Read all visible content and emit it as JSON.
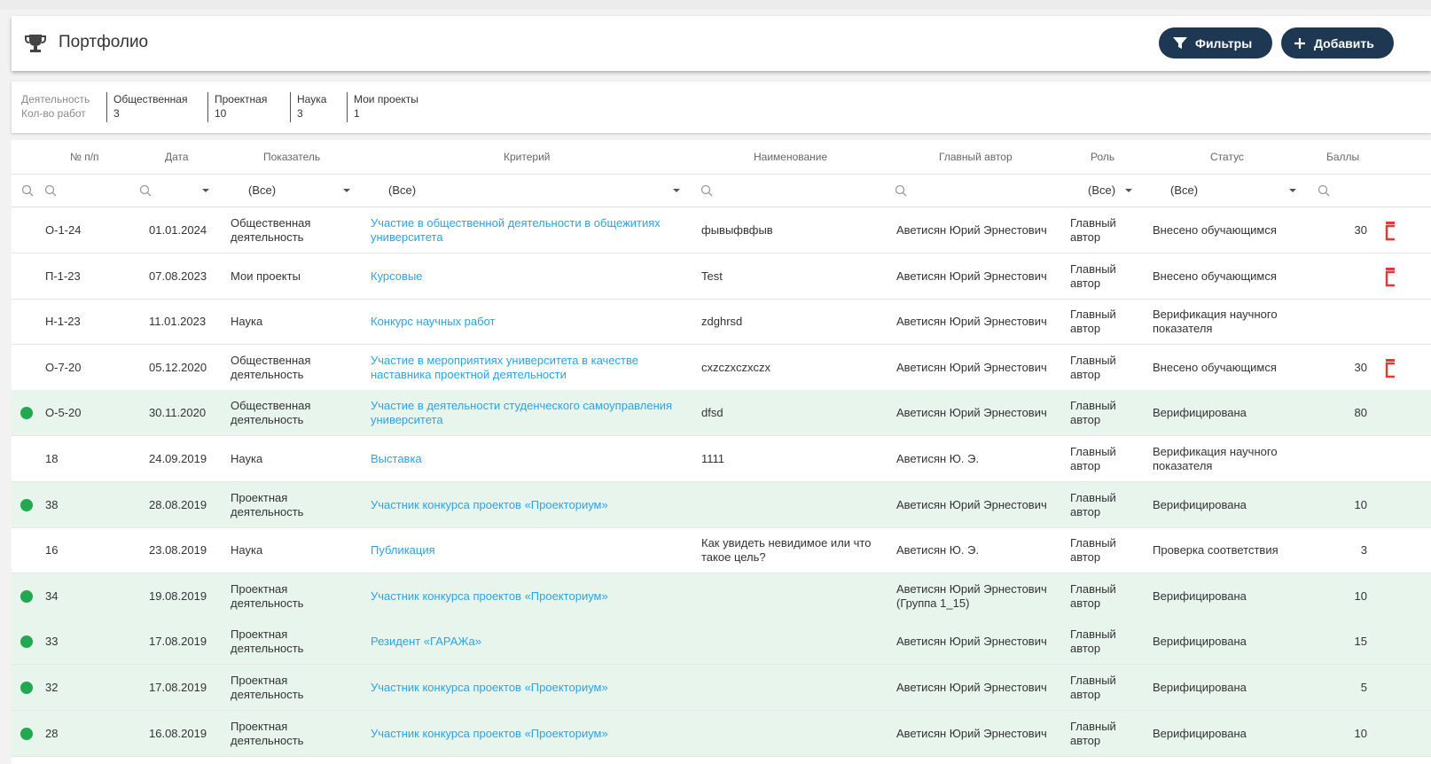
{
  "header": {
    "title": "Портфолио",
    "filters_label": "Фильтры",
    "add_label": "Добавить",
    "icons": {
      "title": "trophy-icon",
      "filters": "filter-icon",
      "add": "plus-icon"
    },
    "button_color": "#1e3752"
  },
  "stats": {
    "label_activity": "Деятельность",
    "label_count": "Кол-во работ",
    "items": [
      {
        "name": "Общественная",
        "count": "3"
      },
      {
        "name": "Проектная",
        "count": "10"
      },
      {
        "name": "Наука",
        "count": "3"
      },
      {
        "name": "Мои проекты",
        "count": "1"
      }
    ]
  },
  "table": {
    "columns": {
      "num": "№ п/п",
      "date": "Дата",
      "indicator": "Показатель",
      "criterion": "Критерий",
      "name": "Наименование",
      "author": "Главный автор",
      "role": "Роль",
      "status": "Статус",
      "score": "Баллы"
    },
    "filters": {
      "indicator": "(Все)",
      "criterion": "(Все)",
      "role": "(Все)",
      "status": "(Все)"
    },
    "rows": [
      {
        "verified": false,
        "num": "О-1-24",
        "date": "01.01.2024",
        "indicator": [
          "Общественная",
          "деятельность"
        ],
        "criterion": [
          "Участие в общественной деятельности в общежитиях",
          "университета"
        ],
        "name": [
          "фывыфвфыв"
        ],
        "author": [
          "Аветисян Юрий Эрнестович"
        ],
        "role": [
          "Главный",
          "автор"
        ],
        "status": [
          "Внесено обучающимся"
        ],
        "score": "30",
        "deletable": true
      },
      {
        "verified": false,
        "num": "П-1-23",
        "date": "07.08.2023",
        "indicator": [
          "Мои проекты"
        ],
        "criterion": [
          "Курсовые"
        ],
        "name": [
          "Test"
        ],
        "author": [
          "Аветисян Юрий Эрнестович"
        ],
        "role": [
          "Главный",
          "автор"
        ],
        "status": [
          "Внесено обучающимся"
        ],
        "score": "",
        "deletable": true
      },
      {
        "verified": false,
        "num": "Н-1-23",
        "date": "11.01.2023",
        "indicator": [
          "Наука"
        ],
        "criterion": [
          "Конкурс научных работ"
        ],
        "name": [
          "zdghrsd"
        ],
        "author": [
          "Аветисян Юрий Эрнестович"
        ],
        "role": [
          "Главный",
          "автор"
        ],
        "status": [
          "Верификация научного",
          "показателя"
        ],
        "score": "",
        "deletable": false
      },
      {
        "verified": false,
        "num": "О-7-20",
        "date": "05.12.2020",
        "indicator": [
          "Общественная",
          "деятельность"
        ],
        "criterion": [
          "Участие в мероприятиях университета в качестве",
          "наставника проектной деятельности"
        ],
        "name": [
          "cxzczxczxczx"
        ],
        "author": [
          "Аветисян Юрий Эрнестович"
        ],
        "role": [
          "Главный",
          "автор"
        ],
        "status": [
          "Внесено обучающимся"
        ],
        "score": "30",
        "deletable": true
      },
      {
        "verified": true,
        "num": "О-5-20",
        "date": "30.11.2020",
        "indicator": [
          "Общественная",
          "деятельность"
        ],
        "criterion": [
          "Участие в деятельности студенческого самоуправления",
          "университета"
        ],
        "name": [
          "dfsd"
        ],
        "author": [
          "Аветисян Юрий Эрнестович"
        ],
        "role": [
          "Главный",
          "автор"
        ],
        "status": [
          "Верифицирована"
        ],
        "score": "80",
        "deletable": false
      },
      {
        "verified": false,
        "num": "18",
        "date": "24.09.2019",
        "indicator": [
          "Наука"
        ],
        "criterion": [
          "Выставка"
        ],
        "name": [
          "1111"
        ],
        "author": [
          "Аветисян Ю. Э."
        ],
        "role": [
          "Главный",
          "автор"
        ],
        "status": [
          "Верификация научного",
          "показателя"
        ],
        "score": "",
        "deletable": false
      },
      {
        "verified": true,
        "num": "38",
        "date": "28.08.2019",
        "indicator": [
          "Проектная",
          "деятельность"
        ],
        "criterion": [
          "Участник конкурса проектов «Проекториум»"
        ],
        "name": [
          ""
        ],
        "author": [
          "Аветисян Юрий Эрнестович"
        ],
        "role": [
          "Главный",
          "автор"
        ],
        "status": [
          "Верифицирована"
        ],
        "score": "10",
        "deletable": false
      },
      {
        "verified": false,
        "num": "16",
        "date": "23.08.2019",
        "indicator": [
          "Наука"
        ],
        "criterion": [
          "Публикация"
        ],
        "name": [
          "Как увидеть невидимое или что",
          "такое цель?"
        ],
        "author": [
          "Аветисян Ю. Э."
        ],
        "role": [
          "Главный",
          "автор"
        ],
        "status": [
          "Проверка соответствия"
        ],
        "score": "3",
        "deletable": false
      },
      {
        "verified": true,
        "num": "34",
        "date": "19.08.2019",
        "indicator": [
          "Проектная",
          "деятельность"
        ],
        "criterion": [
          "Участник конкурса проектов «Проекториум»"
        ],
        "name": [
          ""
        ],
        "author": [
          "Аветисян Юрий Эрнестович",
          "(Группа 1_15)"
        ],
        "role": [
          "Главный",
          "автор"
        ],
        "status": [
          "Верифицирована"
        ],
        "score": "10",
        "deletable": false
      },
      {
        "verified": true,
        "num": "33",
        "date": "17.08.2019",
        "indicator": [
          "Проектная",
          "деятельность"
        ],
        "criterion": [
          "Резидент «ГАРАЖа»"
        ],
        "name": [
          ""
        ],
        "author": [
          "Аветисян Юрий Эрнестович"
        ],
        "role": [
          "Главный",
          "автор"
        ],
        "status": [
          "Верифицирована"
        ],
        "score": "15",
        "deletable": false
      },
      {
        "verified": true,
        "num": "32",
        "date": "17.08.2019",
        "indicator": [
          "Проектная",
          "деятельность"
        ],
        "criterion": [
          "Участник конкурса проектов «Проекториум»"
        ],
        "name": [
          ""
        ],
        "author": [
          "Аветисян Юрий Эрнестович"
        ],
        "role": [
          "Главный",
          "автор"
        ],
        "status": [
          "Верифицирована"
        ],
        "score": "5",
        "deletable": false
      },
      {
        "verified": true,
        "num": "28",
        "date": "16.08.2019",
        "indicator": [
          "Проектная",
          "деятельность"
        ],
        "criterion": [
          "Участник конкурса проектов «Проекториум»"
        ],
        "name": [
          ""
        ],
        "author": [
          "Аветисян Юрий Эрнестович"
        ],
        "role": [
          "Главный",
          "автор"
        ],
        "status": [
          "Верифицирована"
        ],
        "score": "10",
        "deletable": false
      }
    ]
  }
}
